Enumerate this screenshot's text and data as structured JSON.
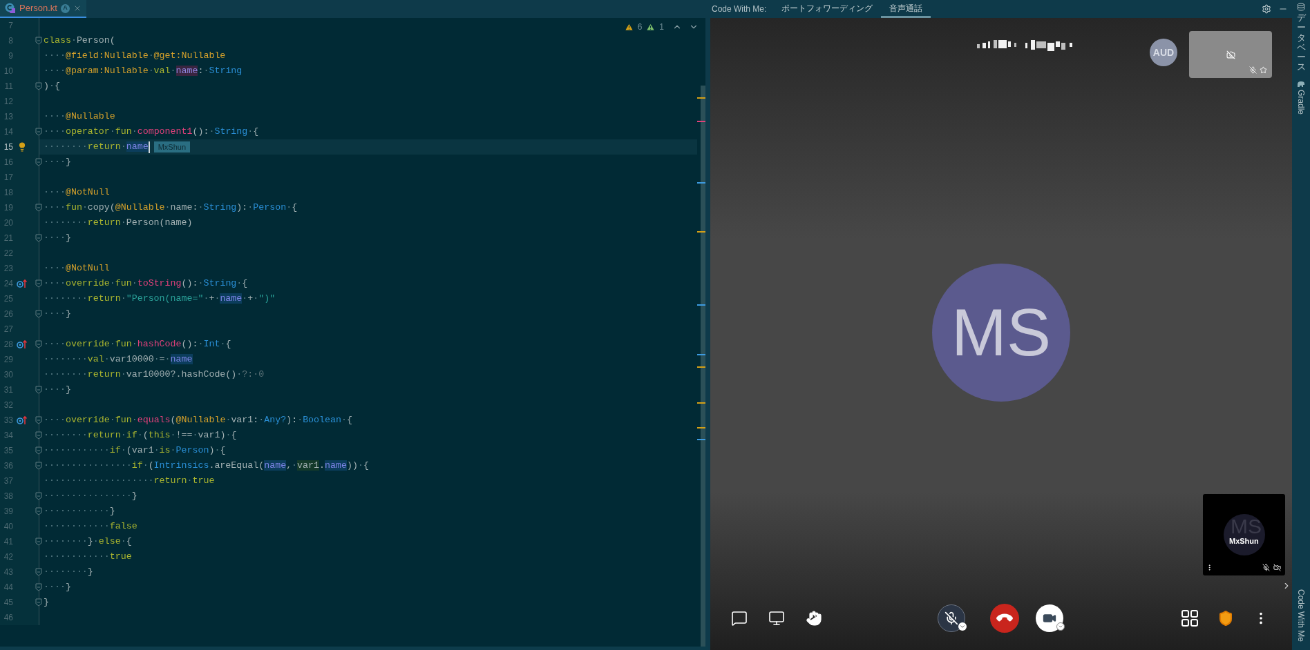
{
  "editor_tab": {
    "label": "Person.kt",
    "badge": "A",
    "selected": true
  },
  "inspections": {
    "warnings": "6",
    "weak_warnings": "1"
  },
  "caret_tooltip": "MxShun",
  "code_lines": [
    {
      "number": "7",
      "current": false,
      "kind": "plain",
      "fold": false
    },
    {
      "number": "8",
      "current": false,
      "kind": "plain",
      "fold": true,
      "tokens": [
        {
          "t": "class",
          "kind": "kw"
        },
        {
          "t": "·",
          "kind": "ws"
        },
        {
          "t": "Person(",
          "kind": "plain"
        }
      ]
    },
    {
      "number": "9",
      "current": false,
      "kind": "plain",
      "fold": false,
      "tokens": [
        {
          "t": "····",
          "kind": "ws"
        },
        {
          "t": "@field:Nullable",
          "kind": "ann"
        },
        {
          "t": "·",
          "kind": "ws"
        },
        {
          "t": "@get:Nullable",
          "kind": "ann"
        }
      ]
    },
    {
      "number": "10",
      "current": false,
      "kind": "plain",
      "fold": false,
      "tokens": [
        {
          "t": "····",
          "kind": "ws"
        },
        {
          "t": "@param:Nullable",
          "kind": "ann"
        },
        {
          "t": "·",
          "kind": "ws"
        },
        {
          "t": "val",
          "kind": "kw"
        },
        {
          "t": "·",
          "kind": "ws"
        },
        {
          "t": "name",
          "kind": "prop-write"
        },
        {
          "t": ":",
          "kind": "plain"
        },
        {
          "t": "·",
          "kind": "ws"
        },
        {
          "t": "String",
          "kind": "type"
        }
      ]
    },
    {
      "number": "11",
      "current": false,
      "kind": "plain",
      "fold": true,
      "tokens": [
        {
          "t": ")",
          "kind": "plain"
        },
        {
          "t": "·",
          "kind": "ws"
        },
        {
          "t": "{",
          "kind": "plain"
        }
      ]
    },
    {
      "number": "12",
      "current": false,
      "kind": "plain",
      "fold": false
    },
    {
      "number": "13",
      "current": false,
      "kind": "plain",
      "fold": false,
      "tokens": [
        {
          "t": "····",
          "kind": "ws"
        },
        {
          "t": "@Nullable",
          "kind": "ann"
        }
      ]
    },
    {
      "number": "14",
      "current": false,
      "kind": "plain",
      "fold": true,
      "tokens": [
        {
          "t": "····",
          "kind": "ws"
        },
        {
          "t": "operator",
          "kind": "kw"
        },
        {
          "t": "·",
          "kind": "ws"
        },
        {
          "t": "fun",
          "kind": "kw"
        },
        {
          "t": "·",
          "kind": "ws"
        },
        {
          "t": "component1",
          "kind": "fn"
        },
        {
          "t": "():",
          "kind": "plain"
        },
        {
          "t": "·",
          "kind": "ws"
        },
        {
          "t": "String",
          "kind": "type"
        },
        {
          "t": "·",
          "kind": "ws"
        },
        {
          "t": "{",
          "kind": "plain"
        }
      ]
    },
    {
      "number": "15",
      "current": true,
      "kind": "bulb",
      "fold": false,
      "tokens": [
        {
          "t": "········",
          "kind": "ws"
        },
        {
          "t": "return",
          "kind": "kw"
        },
        {
          "t": "·",
          "kind": "ws"
        },
        {
          "t": "name",
          "kind": "prop-read"
        }
      ]
    },
    {
      "number": "16",
      "current": false,
      "kind": "plain",
      "fold": true,
      "tokens": [
        {
          "t": "····",
          "kind": "ws"
        },
        {
          "t": "}",
          "kind": "plain"
        }
      ]
    },
    {
      "number": "17",
      "current": false,
      "kind": "plain",
      "fold": false
    },
    {
      "number": "18",
      "current": false,
      "kind": "plain",
      "fold": false,
      "tokens": [
        {
          "t": "····",
          "kind": "ws"
        },
        {
          "t": "@NotNull",
          "kind": "ann"
        }
      ]
    },
    {
      "number": "19",
      "current": false,
      "kind": "plain",
      "fold": true,
      "tokens": [
        {
          "t": "····",
          "kind": "ws"
        },
        {
          "t": "fun",
          "kind": "kw"
        },
        {
          "t": "·",
          "kind": "ws"
        },
        {
          "t": "copy(",
          "kind": "plain"
        },
        {
          "t": "@Nullable",
          "kind": "ann"
        },
        {
          "t": "·",
          "kind": "ws"
        },
        {
          "t": "name:",
          "kind": "plain"
        },
        {
          "t": "·",
          "kind": "ws"
        },
        {
          "t": "String",
          "kind": "type"
        },
        {
          "t": "):",
          "kind": "plain"
        },
        {
          "t": "·",
          "kind": "ws"
        },
        {
          "t": "Person",
          "kind": "type"
        },
        {
          "t": "·",
          "kind": "ws"
        },
        {
          "t": "{",
          "kind": "plain"
        }
      ]
    },
    {
      "number": "20",
      "current": false,
      "kind": "plain",
      "fold": false,
      "tokens": [
        {
          "t": "········",
          "kind": "ws"
        },
        {
          "t": "return",
          "kind": "kw"
        },
        {
          "t": "·",
          "kind": "ws"
        },
        {
          "t": "Person(name)",
          "kind": "plain"
        }
      ]
    },
    {
      "number": "21",
      "current": false,
      "kind": "plain",
      "fold": true,
      "tokens": [
        {
          "t": "····",
          "kind": "ws"
        },
        {
          "t": "}",
          "kind": "plain"
        }
      ]
    },
    {
      "number": "22",
      "current": false,
      "kind": "plain",
      "fold": false
    },
    {
      "number": "23",
      "current": false,
      "kind": "plain",
      "fold": false,
      "tokens": [
        {
          "t": "····",
          "kind": "ws"
        },
        {
          "t": "@NotNull",
          "kind": "ann"
        }
      ]
    },
    {
      "number": "24",
      "current": false,
      "kind": "override",
      "fold": true,
      "tokens": [
        {
          "t": "····",
          "kind": "ws"
        },
        {
          "t": "override",
          "kind": "kw"
        },
        {
          "t": "·",
          "kind": "ws"
        },
        {
          "t": "fun",
          "kind": "kw"
        },
        {
          "t": "·",
          "kind": "ws"
        },
        {
          "t": "toString",
          "kind": "fn"
        },
        {
          "t": "():",
          "kind": "plain"
        },
        {
          "t": "·",
          "kind": "ws"
        },
        {
          "t": "String",
          "kind": "type"
        },
        {
          "t": "·",
          "kind": "ws"
        },
        {
          "t": "{",
          "kind": "plain"
        }
      ]
    },
    {
      "number": "25",
      "current": false,
      "kind": "plain",
      "fold": false,
      "tokens": [
        {
          "t": "········",
          "kind": "ws"
        },
        {
          "t": "return",
          "kind": "kw"
        },
        {
          "t": "·",
          "kind": "ws"
        },
        {
          "t": "\"Person(name=\"",
          "kind": "str"
        },
        {
          "t": "·",
          "kind": "ws"
        },
        {
          "t": "+",
          "kind": "plain"
        },
        {
          "t": "·",
          "kind": "ws"
        },
        {
          "t": "name",
          "kind": "prop-read"
        },
        {
          "t": "·",
          "kind": "ws"
        },
        {
          "t": "+",
          "kind": "plain"
        },
        {
          "t": "·",
          "kind": "ws"
        },
        {
          "t": "\")\"",
          "kind": "str"
        }
      ]
    },
    {
      "number": "26",
      "current": false,
      "kind": "plain",
      "fold": true,
      "tokens": [
        {
          "t": "····",
          "kind": "ws"
        },
        {
          "t": "}",
          "kind": "plain"
        }
      ]
    },
    {
      "number": "27",
      "current": false,
      "kind": "plain",
      "fold": false
    },
    {
      "number": "28",
      "current": false,
      "kind": "override",
      "fold": true,
      "tokens": [
        {
          "t": "····",
          "kind": "ws"
        },
        {
          "t": "override",
          "kind": "kw"
        },
        {
          "t": "·",
          "kind": "ws"
        },
        {
          "t": "fun",
          "kind": "kw"
        },
        {
          "t": "·",
          "kind": "ws"
        },
        {
          "t": "hashCode",
          "kind": "fn"
        },
        {
          "t": "():",
          "kind": "plain"
        },
        {
          "t": "·",
          "kind": "ws"
        },
        {
          "t": "Int",
          "kind": "type"
        },
        {
          "t": "·",
          "kind": "ws"
        },
        {
          "t": "{",
          "kind": "plain"
        }
      ]
    },
    {
      "number": "29",
      "current": false,
      "kind": "plain",
      "fold": false,
      "tokens": [
        {
          "t": "········",
          "kind": "ws"
        },
        {
          "t": "val",
          "kind": "kw"
        },
        {
          "t": "·",
          "kind": "ws"
        },
        {
          "t": "var10000",
          "kind": "plain"
        },
        {
          "t": "·",
          "kind": "ws"
        },
        {
          "t": "=",
          "kind": "plain"
        },
        {
          "t": "·",
          "kind": "ws"
        },
        {
          "t": "name",
          "kind": "prop-read"
        }
      ]
    },
    {
      "number": "30",
      "current": false,
      "kind": "plain",
      "fold": false,
      "tokens": [
        {
          "t": "········",
          "kind": "ws"
        },
        {
          "t": "return",
          "kind": "kw"
        },
        {
          "t": "·",
          "kind": "ws"
        },
        {
          "t": "var10000?.hashCode()",
          "kind": "plain"
        },
        {
          "t": "·",
          "kind": "ws"
        },
        {
          "t": "?:·0",
          "kind": "dim"
        }
      ]
    },
    {
      "number": "31",
      "current": false,
      "kind": "plain",
      "fold": true,
      "tokens": [
        {
          "t": "····",
          "kind": "ws"
        },
        {
          "t": "}",
          "kind": "plain"
        }
      ]
    },
    {
      "number": "32",
      "current": false,
      "kind": "plain",
      "fold": false
    },
    {
      "number": "33",
      "current": false,
      "kind": "override",
      "fold": true,
      "tokens": [
        {
          "t": "····",
          "kind": "ws"
        },
        {
          "t": "override",
          "kind": "kw"
        },
        {
          "t": "·",
          "kind": "ws"
        },
        {
          "t": "fun",
          "kind": "kw"
        },
        {
          "t": "·",
          "kind": "ws"
        },
        {
          "t": "equals",
          "kind": "fn"
        },
        {
          "t": "(",
          "kind": "plain"
        },
        {
          "t": "@Nullable",
          "kind": "ann"
        },
        {
          "t": "·",
          "kind": "ws"
        },
        {
          "t": "var1:",
          "kind": "plain"
        },
        {
          "t": "·",
          "kind": "ws"
        },
        {
          "t": "Any?",
          "kind": "type"
        },
        {
          "t": "):",
          "kind": "plain"
        },
        {
          "t": "·",
          "kind": "ws"
        },
        {
          "t": "Boolean",
          "kind": "type"
        },
        {
          "t": "·",
          "kind": "ws"
        },
        {
          "t": "{",
          "kind": "plain"
        }
      ]
    },
    {
      "number": "34",
      "current": false,
      "kind": "plain",
      "fold": true,
      "tokens": [
        {
          "t": "········",
          "kind": "ws"
        },
        {
          "t": "return",
          "kind": "kw"
        },
        {
          "t": "·",
          "kind": "ws"
        },
        {
          "t": "if",
          "kind": "kw"
        },
        {
          "t": "·",
          "kind": "ws"
        },
        {
          "t": "(",
          "kind": "plain"
        },
        {
          "t": "this",
          "kind": "kw"
        },
        {
          "t": "·",
          "kind": "ws"
        },
        {
          "t": "!==",
          "kind": "plain"
        },
        {
          "t": "·",
          "kind": "ws"
        },
        {
          "t": "var1)",
          "kind": "plain"
        },
        {
          "t": "·",
          "kind": "ws"
        },
        {
          "t": "{",
          "kind": "plain"
        }
      ]
    },
    {
      "number": "35",
      "current": false,
      "kind": "plain",
      "fold": true,
      "tokens": [
        {
          "t": "············",
          "kind": "ws"
        },
        {
          "t": "if",
          "kind": "kw"
        },
        {
          "t": "·",
          "kind": "ws"
        },
        {
          "t": "(var1",
          "kind": "plain"
        },
        {
          "t": "·",
          "kind": "ws"
        },
        {
          "t": "is",
          "kind": "kw"
        },
        {
          "t": "·",
          "kind": "ws"
        },
        {
          "t": "Person",
          "kind": "type"
        },
        {
          "t": ")",
          "kind": "plain"
        },
        {
          "t": "·",
          "kind": "ws"
        },
        {
          "t": "{",
          "kind": "plain"
        }
      ]
    },
    {
      "number": "36",
      "current": false,
      "kind": "plain",
      "fold": true,
      "tokens": [
        {
          "t": "················",
          "kind": "ws"
        },
        {
          "t": "if",
          "kind": "kw"
        },
        {
          "t": "·",
          "kind": "ws"
        },
        {
          "t": "(",
          "kind": "plain"
        },
        {
          "t": "Intrinsics",
          "kind": "type"
        },
        {
          "t": ".areEqual(",
          "kind": "plain"
        },
        {
          "t": "name",
          "kind": "prop-read"
        },
        {
          "t": ",",
          "kind": "plain"
        },
        {
          "t": "·",
          "kind": "ws"
        },
        {
          "t": "var1",
          "kind": "local"
        },
        {
          "t": ".",
          "kind": "plain"
        },
        {
          "t": "name",
          "kind": "prop-read"
        },
        {
          "t": "))",
          "kind": "plain"
        },
        {
          "t": "·",
          "kind": "ws"
        },
        {
          "t": "{",
          "kind": "plain"
        }
      ]
    },
    {
      "number": "37",
      "current": false,
      "kind": "plain",
      "fold": false,
      "tokens": [
        {
          "t": "····················",
          "kind": "ws"
        },
        {
          "t": "return",
          "kind": "kw"
        },
        {
          "t": "·",
          "kind": "ws"
        },
        {
          "t": "true",
          "kind": "kw"
        }
      ]
    },
    {
      "number": "38",
      "current": false,
      "kind": "plain",
      "fold": true,
      "tokens": [
        {
          "t": "················",
          "kind": "ws"
        },
        {
          "t": "}",
          "kind": "plain"
        }
      ]
    },
    {
      "number": "39",
      "current": false,
      "kind": "plain",
      "fold": true,
      "tokens": [
        {
          "t": "············",
          "kind": "ws"
        },
        {
          "t": "}",
          "kind": "plain"
        }
      ]
    },
    {
      "number": "40",
      "current": false,
      "kind": "plain",
      "fold": false,
      "tokens": [
        {
          "t": "············",
          "kind": "ws"
        },
        {
          "t": "false",
          "kind": "kw"
        }
      ]
    },
    {
      "number": "41",
      "current": false,
      "kind": "plain",
      "fold": true,
      "tokens": [
        {
          "t": "········",
          "kind": "ws"
        },
        {
          "t": "}",
          "kind": "plain"
        },
        {
          "t": "·",
          "kind": "ws"
        },
        {
          "t": "else",
          "kind": "kw"
        },
        {
          "t": "·",
          "kind": "ws"
        },
        {
          "t": "{",
          "kind": "plain"
        }
      ]
    },
    {
      "number": "42",
      "current": false,
      "kind": "plain",
      "fold": false,
      "tokens": [
        {
          "t": "············",
          "kind": "ws"
        },
        {
          "t": "true",
          "kind": "kw"
        }
      ]
    },
    {
      "number": "43",
      "current": false,
      "kind": "plain",
      "fold": true,
      "tokens": [
        {
          "t": "········",
          "kind": "ws"
        },
        {
          "t": "}",
          "kind": "plain"
        }
      ]
    },
    {
      "number": "44",
      "current": false,
      "kind": "plain",
      "fold": true,
      "tokens": [
        {
          "t": "····",
          "kind": "ws"
        },
        {
          "t": "}",
          "kind": "plain"
        }
      ]
    },
    {
      "number": "45",
      "current": false,
      "kind": "plain",
      "fold": true,
      "tokens": [
        {
          "t": "}",
          "kind": "plain"
        }
      ]
    },
    {
      "number": "46",
      "current": false,
      "kind": "plain",
      "fold": false
    }
  ],
  "call_panel": {
    "label": "Code With Me:",
    "tabs": [
      {
        "label": "ポートフォワーディング",
        "selected": false
      },
      {
        "label": "音声通話",
        "selected": true
      }
    ]
  },
  "call": {
    "participant_initials": "AUD",
    "main_avatar_initials": "MS",
    "self_initials": "MS",
    "self_name": "MxShun"
  },
  "side_tools_top": [
    {
      "label": "データベース",
      "kind": "cjk"
    },
    {
      "label": "Gradle",
      "kind": "latin"
    }
  ],
  "side_tools_bottom": [
    {
      "label": "Code With Me",
      "kind": "latin"
    }
  ]
}
